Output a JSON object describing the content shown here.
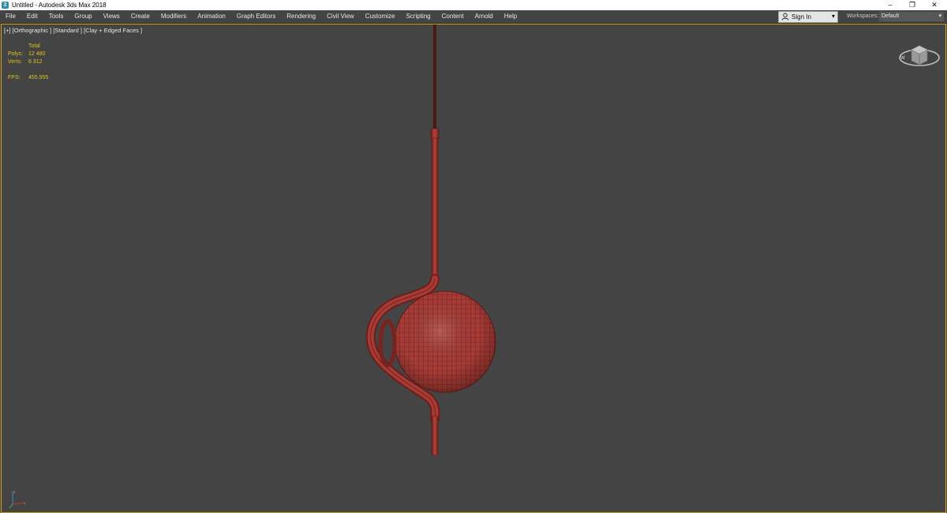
{
  "window": {
    "title": "Untitled - Autodesk 3ds Max 2018",
    "app_icon_glyph": "3",
    "controls": {
      "minimize": "–",
      "restore": "❐",
      "close": "✕"
    }
  },
  "menu": {
    "items": [
      "File",
      "Edit",
      "Tools",
      "Group",
      "Views",
      "Create",
      "Modifiers",
      "Animation",
      "Graph Editors",
      "Rendering",
      "Civil View",
      "Customize",
      "Scripting",
      "Content",
      "Arnold",
      "Help"
    ]
  },
  "account": {
    "sign_in_label": "Sign In",
    "caret": "▾"
  },
  "workspaces": {
    "label": "Workspaces:",
    "value": "Default",
    "caret": "▾"
  },
  "viewport": {
    "label": "[+] [Orthographic ] [Standard ] [Clay + Edged Faces ]",
    "border_color": "#c9a227",
    "stats": {
      "header": "Total",
      "polys_label": "Polys:",
      "polys_value": "12 480",
      "verts_label": "Verts:",
      "verts_value": "6 312",
      "fps_label": "FPS:",
      "fps_value": "455.955"
    }
  },
  "colors": {
    "model_fill": "#a33a34",
    "model_wire": "#5a1512",
    "stats_text": "#e0c020",
    "viewport_bg": "#444444"
  },
  "icons": [
    "app-icon",
    "user-icon",
    "viewcube-icon",
    "axis-tripod-icon",
    "chevron-down-icon"
  ]
}
